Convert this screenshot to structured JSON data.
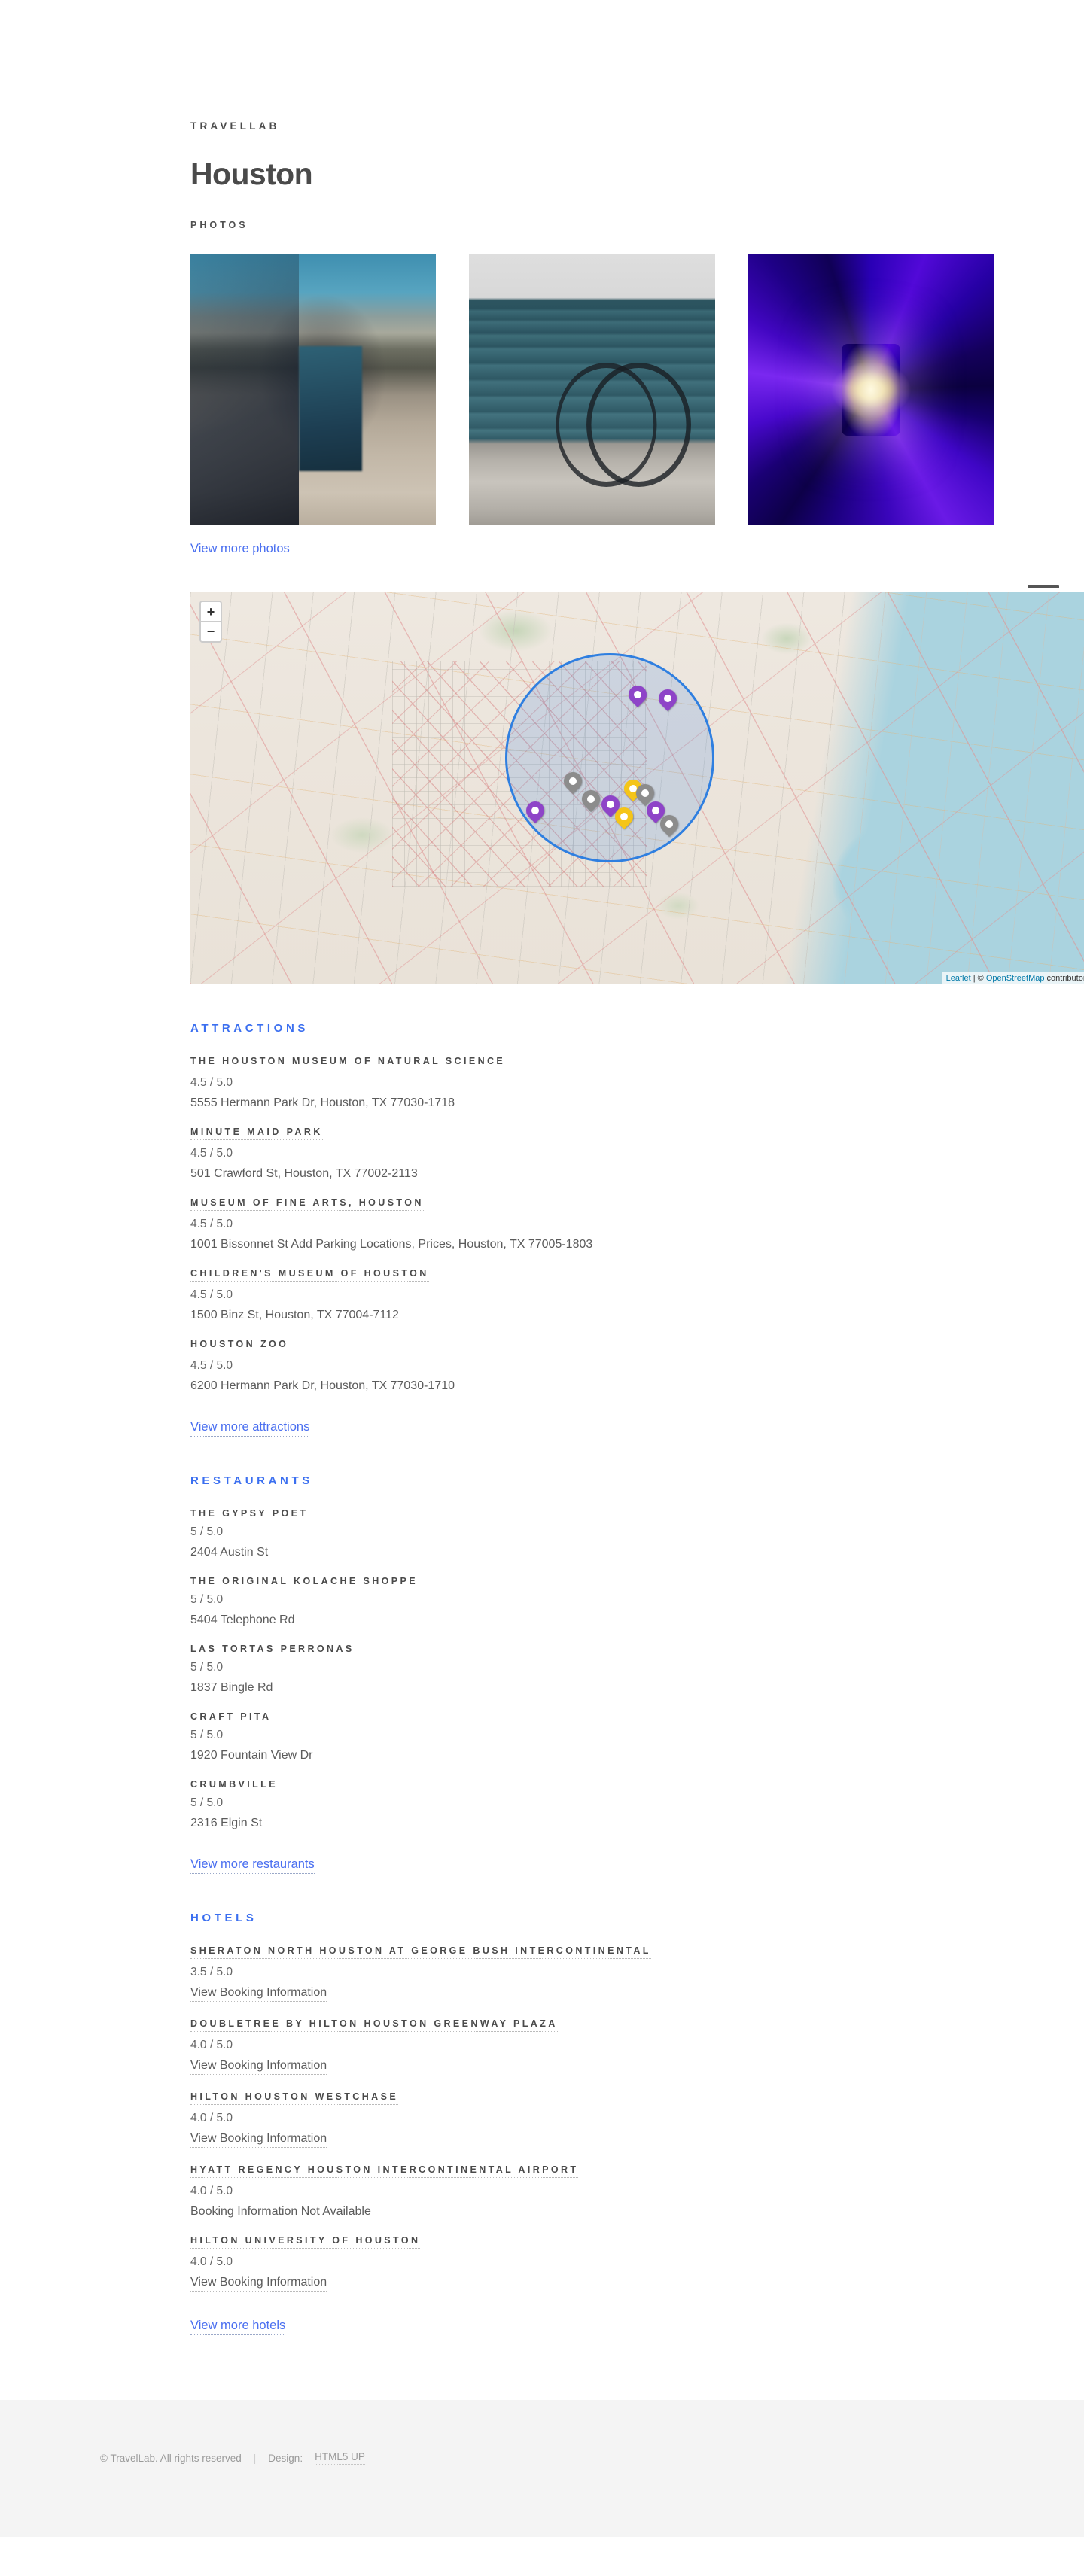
{
  "header": {
    "site_title": "TRAVELLAB",
    "page_title": "Houston",
    "menu_icon": "hamburger-icon"
  },
  "photos": {
    "label": "PHOTOS",
    "items": [
      {
        "alt": "Woman sitting on concrete ledge in city park"
      },
      {
        "alt": "Bicycle leaning against teal garage door"
      },
      {
        "alt": "Purple and blue neon light tunnel"
      }
    ],
    "more_label": "View more photos"
  },
  "map": {
    "zoom_in_label": "+",
    "zoom_out_label": "−",
    "attribution_prefix": "Leaflet",
    "attribution_sep": " | © ",
    "attribution_osm": "OpenStreetMap",
    "attribution_suffix": " contributors",
    "markers": [
      {
        "color": "purple",
        "x": 49.5,
        "y": 30.5
      },
      {
        "color": "purple",
        "x": 52.8,
        "y": 31.5
      },
      {
        "color": "gray",
        "x": 42.3,
        "y": 52.5
      },
      {
        "color": "gray",
        "x": 44.3,
        "y": 57.0
      },
      {
        "color": "purple",
        "x": 38.2,
        "y": 60.0
      },
      {
        "color": "purple",
        "x": 46.5,
        "y": 58.5
      },
      {
        "color": "gold",
        "x": 49.0,
        "y": 54.5
      },
      {
        "color": "gray",
        "x": 50.3,
        "y": 55.5
      },
      {
        "color": "gold",
        "x": 48.0,
        "y": 61.5
      },
      {
        "color": "purple",
        "x": 51.5,
        "y": 60.0
      },
      {
        "color": "gray",
        "x": 53.0,
        "y": 63.5
      }
    ]
  },
  "attractions": {
    "heading": "ATTRACTIONS",
    "items": [
      {
        "name": "THE HOUSTON MUSEUM OF NATURAL SCIENCE",
        "rating": "4.5 / 5.0",
        "address": "5555 Hermann Park Dr, Houston, TX 77030-1718"
      },
      {
        "name": "MINUTE MAID PARK",
        "rating": "4.5 / 5.0",
        "address": "501 Crawford St, Houston, TX 77002-2113"
      },
      {
        "name": "MUSEUM OF FINE ARTS, HOUSTON",
        "rating": "4.5 / 5.0",
        "address": "1001 Bissonnet St Add Parking Locations, Prices, Houston, TX 77005-1803"
      },
      {
        "name": "CHILDREN'S MUSEUM OF HOUSTON",
        "rating": "4.5 / 5.0",
        "address": "1500 Binz St, Houston, TX 77004-7112"
      },
      {
        "name": "HOUSTON ZOO",
        "rating": "4.5 / 5.0",
        "address": "6200 Hermann Park Dr, Houston, TX 77030-1710"
      }
    ],
    "more_label": "View more attractions"
  },
  "restaurants": {
    "heading": "RESTAURANTS",
    "items": [
      {
        "name": "THE GYPSY POET",
        "rating": "5 / 5.0",
        "address": "2404 Austin St"
      },
      {
        "name": "THE ORIGINAL KOLACHE SHOPPE",
        "rating": "5 / 5.0",
        "address": "5404 Telephone Rd"
      },
      {
        "name": "LAS TORTAS PERRONAS",
        "rating": "5 / 5.0",
        "address": "1837 Bingle Rd"
      },
      {
        "name": "CRAFT PITA",
        "rating": "5 / 5.0",
        "address": "1920 Fountain View Dr"
      },
      {
        "name": "CRUMBVILLE",
        "rating": "5 / 5.0",
        "address": "2316 Elgin St"
      }
    ],
    "more_label": "View more restaurants"
  },
  "hotels": {
    "heading": "HOTELS",
    "items": [
      {
        "name": "SHERATON NORTH HOUSTON AT GEORGE BUSH INTERCONTINENTAL",
        "rating": "3.5 / 5.0",
        "booking": "View Booking Information",
        "booking_available": true
      },
      {
        "name": "DOUBLETREE BY HILTON HOUSTON GREENWAY PLAZA",
        "rating": "4.0 / 5.0",
        "booking": "View Booking Information",
        "booking_available": true
      },
      {
        "name": "HILTON HOUSTON WESTCHASE",
        "rating": "4.0 / 5.0",
        "booking": "View Booking Information",
        "booking_available": true
      },
      {
        "name": "HYATT REGENCY HOUSTON INTERCONTINENTAL AIRPORT",
        "rating": "4.0 / 5.0",
        "booking": "Booking Information Not Available",
        "booking_available": false
      },
      {
        "name": "HILTON UNIVERSITY OF HOUSTON",
        "rating": "4.0 / 5.0",
        "booking": "View Booking Information",
        "booking_available": true
      }
    ],
    "more_label": "View more hotels"
  },
  "footer": {
    "copyright": "© TravelLab. All rights reserved",
    "separator": "|",
    "design_prefix": "Design:",
    "design_link": "HTML5 UP"
  },
  "colors": {
    "accent_blue": "#3b6ff0",
    "link_blue": "#4a6ff0",
    "text_dark": "#4a4a4a",
    "marker_purple": "#8e44c8",
    "marker_gray": "#8c8c8c",
    "marker_gold": "#f5c518"
  }
}
